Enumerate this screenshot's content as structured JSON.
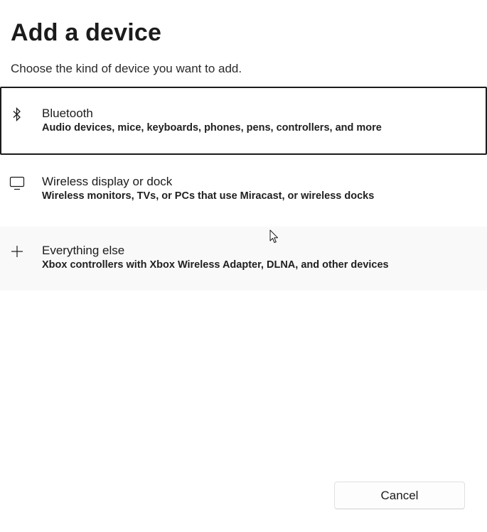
{
  "dialog": {
    "title": "Add a device",
    "subtitle": "Choose the kind of device you want to add."
  },
  "options": [
    {
      "icon": "bluetooth-icon",
      "title": "Bluetooth",
      "description": "Audio devices, mice, keyboards, phones, pens, controllers, and more",
      "state": "selected"
    },
    {
      "icon": "monitor-icon",
      "title": "Wireless display or dock",
      "description": "Wireless monitors, TVs, or PCs that use Miracast, or wireless docks",
      "state": "normal"
    },
    {
      "icon": "plus-icon",
      "title": "Everything else",
      "description": "Xbox controllers with Xbox Wireless Adapter, DLNA, and other devices",
      "state": "hover"
    }
  ],
  "footer": {
    "cancel_label": "Cancel"
  },
  "colors": {
    "text": "#1b1b1b",
    "selected_border": "#1b1b1b",
    "hover_background": "#f9f9f9",
    "button_background": "#fdfdfd"
  }
}
